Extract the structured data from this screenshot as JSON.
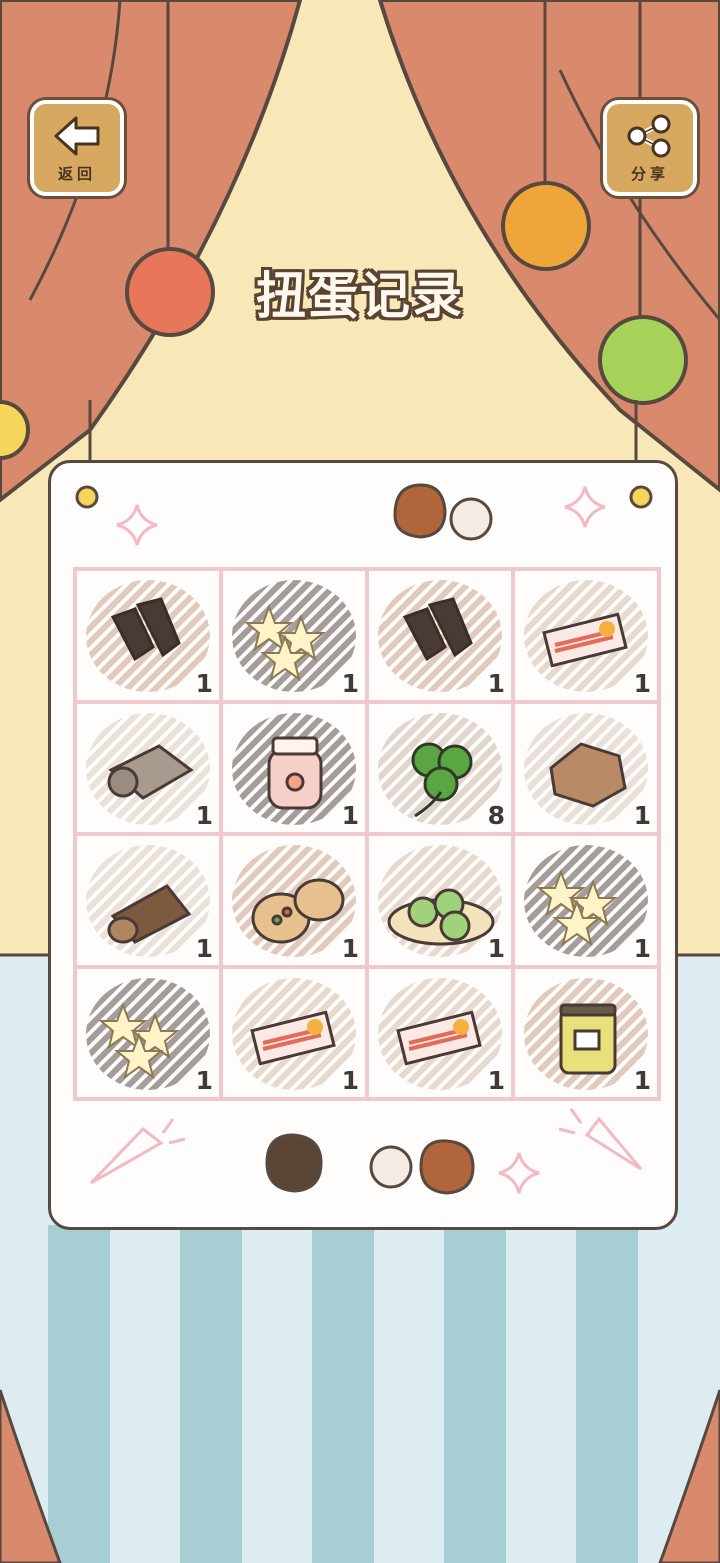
{
  "header": {
    "title": "扭蛋记录",
    "back_label": "返回",
    "share_label": "分享"
  },
  "colors": {
    "curtain": "#d98a6c",
    "wall": "#f8e8b8",
    "floor_light": "#dcecf0",
    "floor_stripe": "#a7ced3",
    "cell_border": "#f2c8cf",
    "outline": "#57493f"
  },
  "items": [
    {
      "name": "dried-meat-icon",
      "count": "1"
    },
    {
      "name": "star-cookies-icon",
      "count": "1"
    },
    {
      "name": "dried-meat-icon",
      "count": "1"
    },
    {
      "name": "fish-cake-icon",
      "count": "1"
    },
    {
      "name": "rolled-cloth-icon",
      "count": "1"
    },
    {
      "name": "peach-jam-jar-icon",
      "count": "1"
    },
    {
      "name": "clover-icon",
      "count": "8"
    },
    {
      "name": "rock-candy-icon",
      "count": "1"
    },
    {
      "name": "log-cake-icon",
      "count": "1"
    },
    {
      "name": "pita-bread-icon",
      "count": "1"
    },
    {
      "name": "green-dumplings-icon",
      "count": "1"
    },
    {
      "name": "star-cookies-icon",
      "count": "1"
    },
    {
      "name": "star-cookies-icon",
      "count": "1"
    },
    {
      "name": "fish-cake-icon",
      "count": "1"
    },
    {
      "name": "fish-cake-icon",
      "count": "1"
    },
    {
      "name": "bean-jar-icon",
      "count": "1"
    }
  ]
}
